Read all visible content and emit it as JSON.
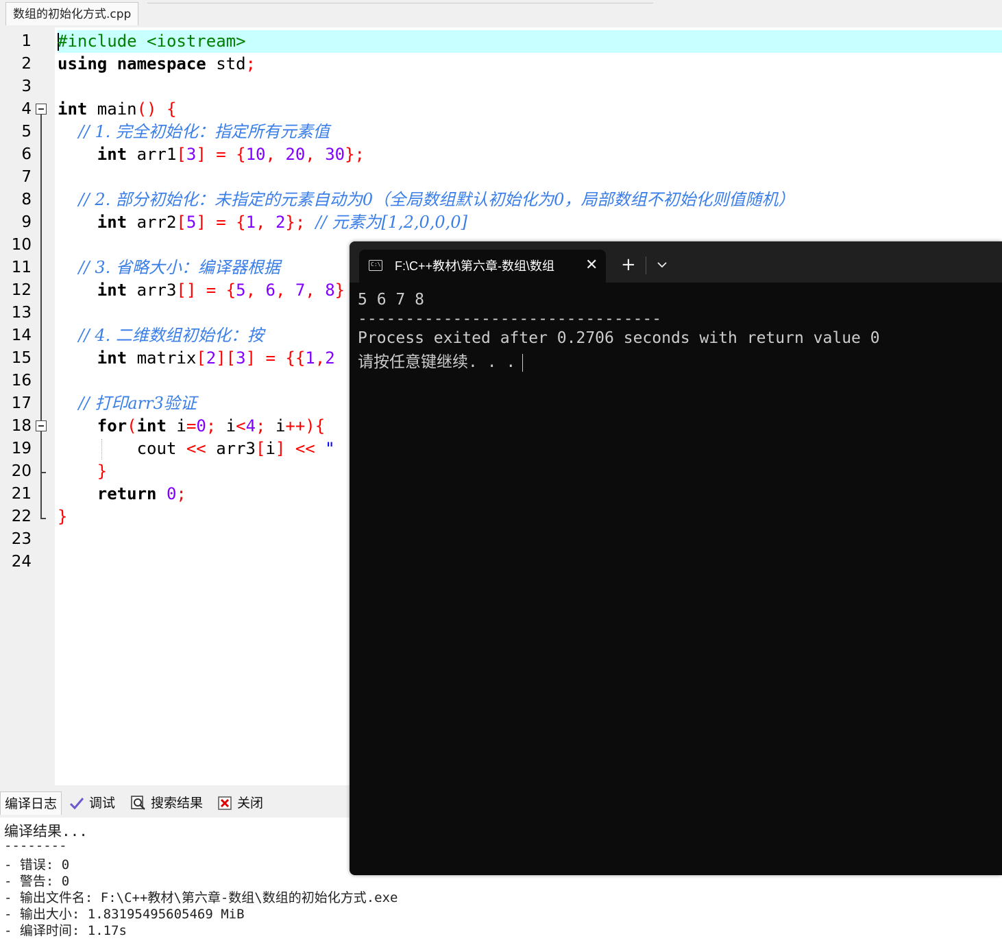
{
  "editor": {
    "file_tab": "数组的初始化方式.cpp",
    "line_numbers": [
      "1",
      "2",
      "3",
      "4",
      "5",
      "6",
      "7",
      "8",
      "9",
      "10",
      "11",
      "12",
      "13",
      "14",
      "15",
      "16",
      "17",
      "18",
      "19",
      "20",
      "21",
      "22",
      "23",
      "24"
    ],
    "code": {
      "l1a": "#include <iostream>",
      "l2a": "using",
      "l2b": " ",
      "l2c": "namespace",
      "l2d": " std",
      "l2e": ";",
      "l4a": "int",
      "l4b": " main",
      "l4c": "()",
      "l4d": " ",
      "l4e": "{",
      "l5a": "    // 1. 完全初始化：指定所有元素值",
      "l6a": "    ",
      "l6b": "int",
      "l6c": " arr1",
      "l6d": "[",
      "l6e": "3",
      "l6f": "]",
      "l6g": " ",
      "l6h": "=",
      "l6i": " ",
      "l6j": "{",
      "l6k": "10",
      "l6l": ",",
      "l6m": " ",
      "l6n": "20",
      "l6o": ",",
      "l6p": " ",
      "l6q": "30",
      "l6r": "};",
      "l8a": "    // 2. 部分初始化：未指定的元素自动为0（全局数组默认初始化为0，局部数组不初始化则值随机）",
      "l9a": "    ",
      "l9b": "int",
      "l9c": " arr2",
      "l9d": "[",
      "l9e": "5",
      "l9f": "]",
      "l9g": " ",
      "l9h": "=",
      "l9i": " ",
      "l9j": "{",
      "l9k": "1",
      "l9l": ",",
      "l9m": " ",
      "l9n": "2",
      "l9o": "};",
      "l9p": "  // 元素为[1,2,0,0,0]",
      "l11a": "    // 3. 省略大小：编译器根据",
      "l12a": "    ",
      "l12b": "int",
      "l12c": " arr3",
      "l12d": "[]",
      "l12e": " ",
      "l12f": "=",
      "l12g": " ",
      "l12h": "{",
      "l12i": "5",
      "l12j": ",",
      "l12k": " ",
      "l12l": "6",
      "l12m": ",",
      "l12n": " ",
      "l12o": "7",
      "l12p": ",",
      "l12q": " ",
      "l12r": "8",
      "l12s": "}",
      "l14a": "    // 4. 二维数组初始化：按",
      "l15a": "    ",
      "l15b": "int",
      "l15c": " matrix",
      "l15d": "[",
      "l15e": "2",
      "l15f": "][",
      "l15g": "3",
      "l15h": "]",
      "l15i": " ",
      "l15j": "=",
      "l15k": " ",
      "l15l": "{{",
      "l15m": "1",
      "l15n": ",",
      "l15o": "2",
      "l17a": "    // 打印arr3验证",
      "l18a": "    ",
      "l18b": "for",
      "l18c": "(",
      "l18d": "int",
      "l18e": " i",
      "l18f": "=",
      "l18g": "0",
      "l18h": ";",
      "l18i": " i",
      "l18j": "<",
      "l18k": "4",
      "l18l": ";",
      "l18m": " i",
      "l18n": "++){",
      "l19a": "        cout ",
      "l19b": "<<",
      "l19c": " arr3",
      "l19d": "[",
      "l19e": "i",
      "l19f": "]",
      "l19g": " ",
      "l19h": "<<",
      "l19i": " ",
      "l19j": "\"",
      "l20a": "    ",
      "l20b": "}",
      "l21a": "    ",
      "l21b": "return",
      "l21c": " ",
      "l21d": "0",
      "l21e": ";",
      "l22a": "}"
    }
  },
  "bottom_panel": {
    "tabs": [
      {
        "label": "编译日志",
        "icon": "compile-log-icon"
      },
      {
        "label": "调试",
        "icon": "debug-check-icon"
      },
      {
        "label": "搜索结果",
        "icon": "search-results-icon"
      },
      {
        "label": "关闭",
        "icon": "close-panel-icon"
      }
    ],
    "log_lines": [
      "编译结果...",
      "--------",
      "- 错误: 0",
      "- 警告: 0",
      "- 输出文件名: F:\\C++教材\\第六章-数组\\数组的初始化方式.exe",
      "- 输出大小: 1.83195495605469 MiB",
      "- 编译时间: 1.17s"
    ]
  },
  "terminal": {
    "tab_title": "F:\\C++教材\\第六章-数组\\数组",
    "tab_icon": "cmd-icon",
    "close_glyph": "✕",
    "new_tab_glyph": "+",
    "lines": [
      "5 6 7 8",
      "--------------------------------",
      "Process exited after 0.2706 seconds with return value 0",
      "请按任意键继续. . ."
    ]
  },
  "colors": {
    "current_line": "#c8ffff",
    "keyword": "#000000",
    "preprocessor": "#008000",
    "number": "#8000ff",
    "symbol": "#ff0000",
    "comment": "#3a7ee8",
    "terminal_bg": "#0c0c0c",
    "terminal_titlebar": "#202020"
  }
}
